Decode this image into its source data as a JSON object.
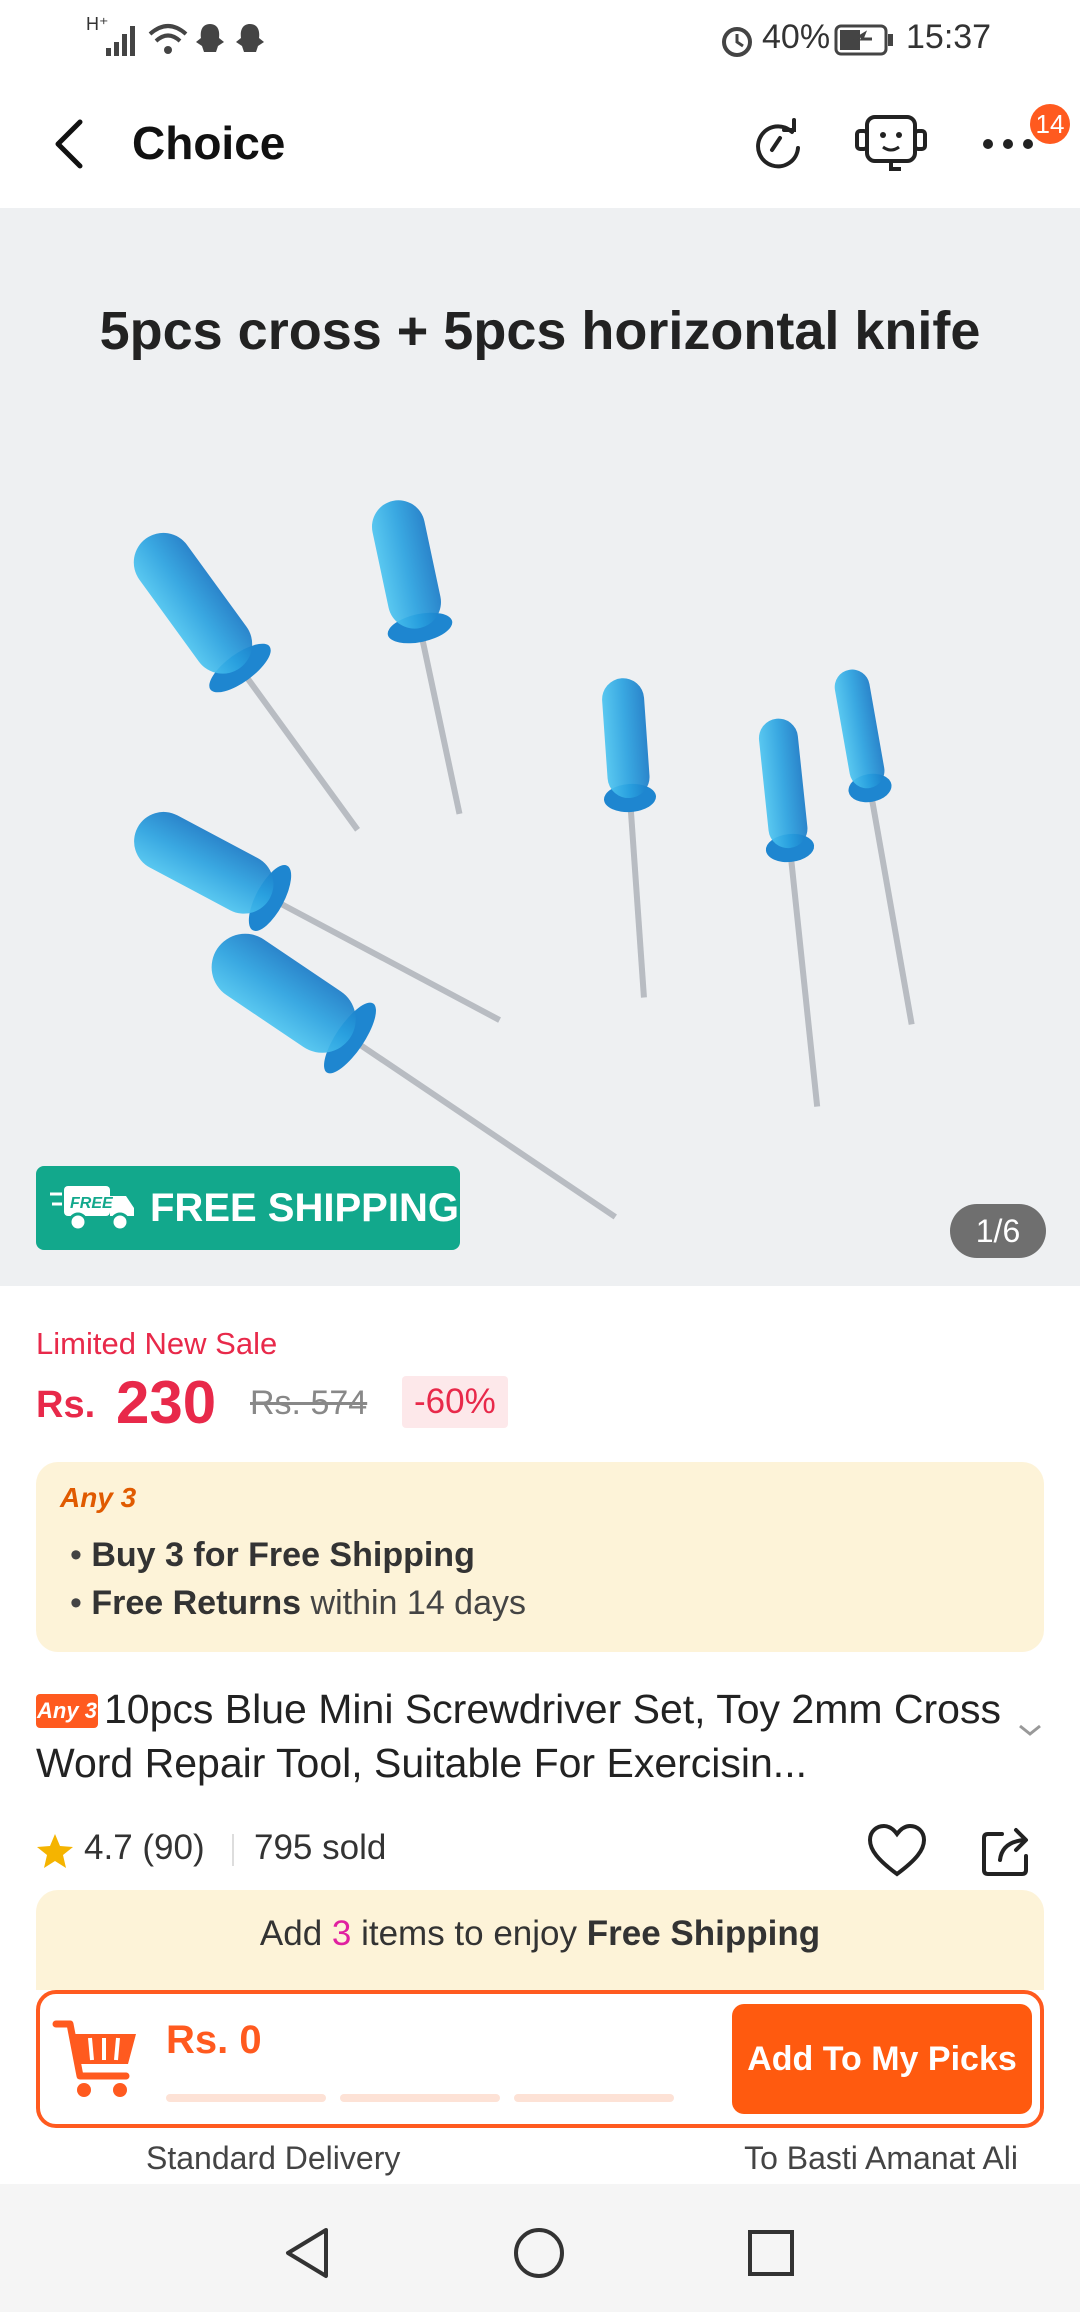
{
  "status_bar": {
    "signal": "H⁺",
    "battery_percent": "40%",
    "time": "15:37"
  },
  "header": {
    "title": "Choice",
    "notification_count": "14"
  },
  "product_image": {
    "caption": "5pcs cross + 5pcs horizontal knife",
    "badge_small": "FREE",
    "badge_text": "FREE SHIPPING",
    "counter": "1/6"
  },
  "price": {
    "sale_label": "Limited New Sale",
    "currency": "Rs.",
    "current": "230",
    "original": "Rs. 574",
    "discount": "-60%"
  },
  "promo": {
    "title": "Any 3",
    "line1_bold": "Buy 3 for  Free Shipping",
    "line2_bold": "Free Returns",
    "line2_rest": " within 14 days"
  },
  "product": {
    "tag": "Any 3",
    "title": "10pcs Blue Mini Screwdriver Set, Toy 2mm Cross Word Repair Tool, Suitable For Exercisin..."
  },
  "rating": {
    "score": "4.7 (90)",
    "sold": "795 sold"
  },
  "cart_bar": {
    "banner_prefix": "Add ",
    "banner_count": "3",
    "banner_middle": " items to enjoy ",
    "banner_bold": "Free Shipping",
    "total": "Rs. 0",
    "progress": 0,
    "button_label": "Add To My Picks",
    "delivery_left": "Standard Delivery",
    "delivery_right": "To Basti Amanat Ali"
  },
  "colors": {
    "accent": "#ff5a1f",
    "price": "#e8294a",
    "free_shipping": "#12a88c",
    "promo_bg": "#fdf3d8"
  }
}
